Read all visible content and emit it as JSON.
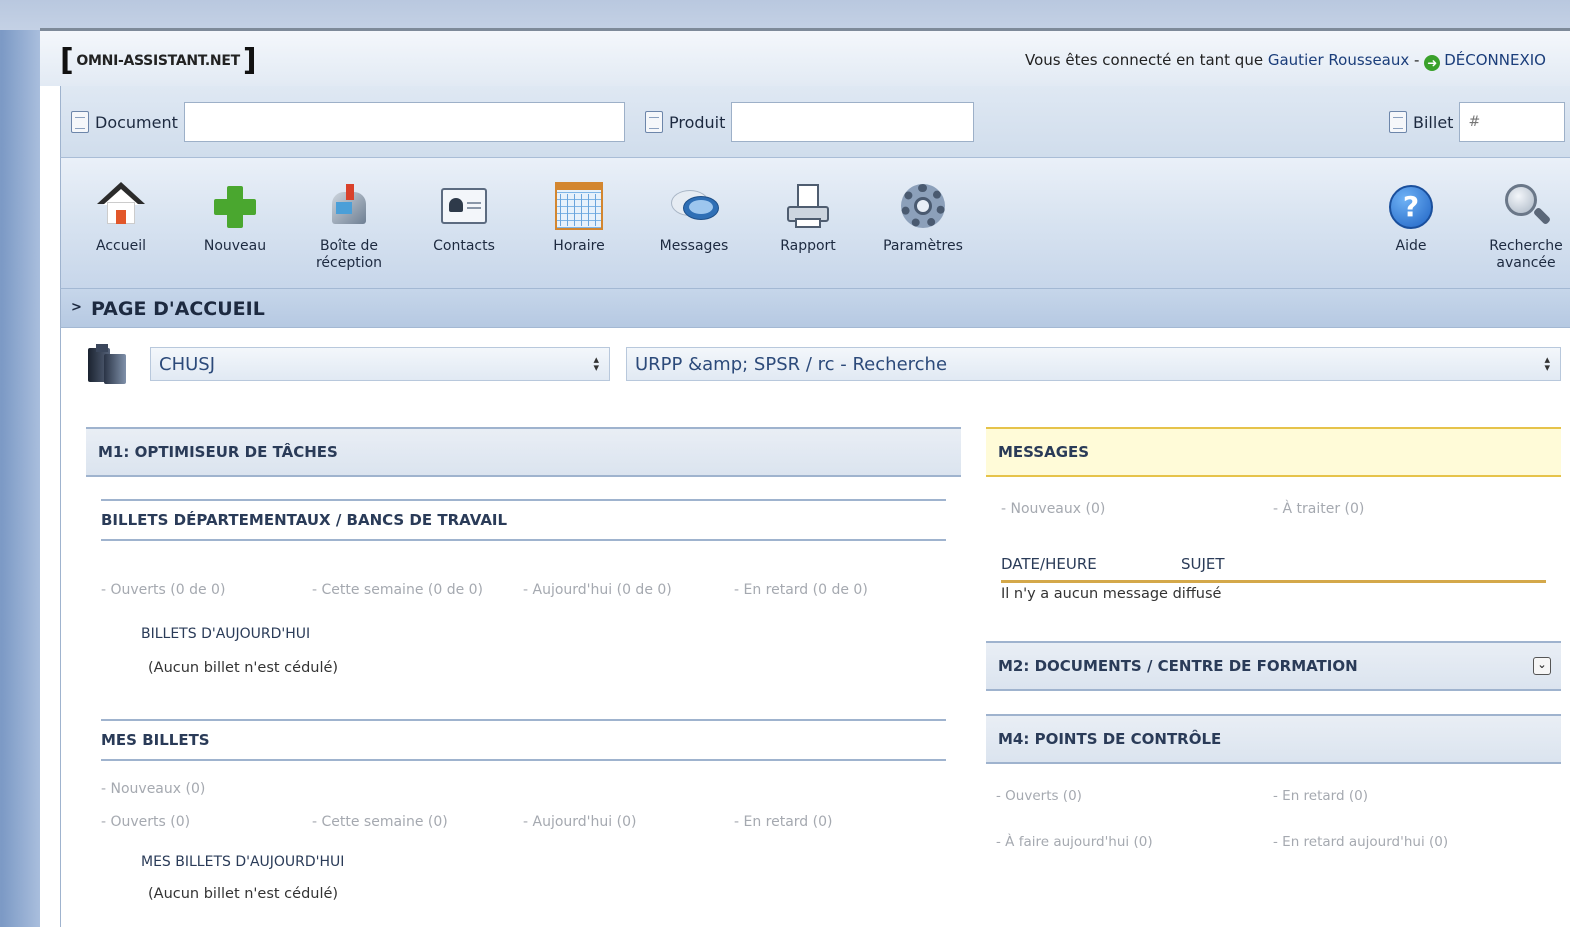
{
  "header": {
    "logo": "OMNI-ASSISTANT.NET",
    "connected_prefix": "Vous êtes connecté en tant que",
    "user_name": "Gautier Rousseaux",
    "separator": " - ",
    "logout_label": "DÉCONNEXIO"
  },
  "search": {
    "document_label": "Document",
    "document_value": "",
    "produit_label": "Produit",
    "produit_value": "",
    "billet_label": "Billet",
    "billet_placeholder": "#"
  },
  "toolbar": {
    "items": [
      {
        "label": "Accueil",
        "icon": "home-icon"
      },
      {
        "label": "Nouveau",
        "icon": "plus-icon"
      },
      {
        "label": "Boîte de\nréception",
        "icon": "mailbox-icon"
      },
      {
        "label": "Contacts",
        "icon": "contact-card-icon"
      },
      {
        "label": "Horaire",
        "icon": "calendar-icon"
      },
      {
        "label": "Messages",
        "icon": "chat-bubbles-icon"
      },
      {
        "label": "Rapport",
        "icon": "printer-icon"
      },
      {
        "label": "Paramètres",
        "icon": "gear-icon"
      },
      {
        "label": "Aide",
        "icon": "help-icon"
      },
      {
        "label": "Recherche\navancée",
        "icon": "magnifier-icon"
      }
    ]
  },
  "page": {
    "title": "PAGE D'ACCUEIL"
  },
  "selectors": {
    "site": "CHUSJ",
    "department": "URPP &amp; SPSR / rc - Recherche"
  },
  "m1": {
    "title": "M1: OPTIMISEUR DE TÂCHES",
    "dept": {
      "title": "BILLETS DÉPARTEMENTAUX / BANCS DE TRAVAIL",
      "stats": [
        "- Ouverts (0 de 0)",
        "- Cette semaine (0 de 0)",
        "- Aujourd'hui (0 de 0)",
        "- En retard (0 de 0)"
      ],
      "today_heading": "BILLETS D'AUJOURD'HUI",
      "empty_note": "(Aucun billet n'est cédulé)"
    },
    "mine": {
      "title": "MES BILLETS",
      "new_stat": "- Nouveaux (0)",
      "stats": [
        "- Ouverts (0)",
        "- Cette semaine (0)",
        "- Aujourd'hui (0)",
        "- En retard (0)"
      ],
      "today_heading": "MES BILLETS D'AUJOURD'HUI",
      "empty_note": "(Aucun billet n'est cédulé)"
    }
  },
  "messages": {
    "title": "MESSAGES",
    "new_stat": "- Nouveaux (0)",
    "todo_stat": "- À traiter (0)",
    "col_date": "DATE/HEURE",
    "col_subject": "SUJET",
    "empty": "Il n'y a aucun message diffusé"
  },
  "m2": {
    "title": "M2: DOCUMENTS / CENTRE DE FORMATION"
  },
  "m4": {
    "title": "M4: POINTS DE CONTRÔLE",
    "open": "- Ouverts (0)",
    "late": "- En retard (0)",
    "today": "- À faire aujourd'hui (0)",
    "late_today": "- En retard aujourd'hui (0)"
  },
  "colors": {
    "accent": "#1a3d7a",
    "toolbar_bg": "#d9e4f1",
    "messages_border": "#e6c34a"
  }
}
